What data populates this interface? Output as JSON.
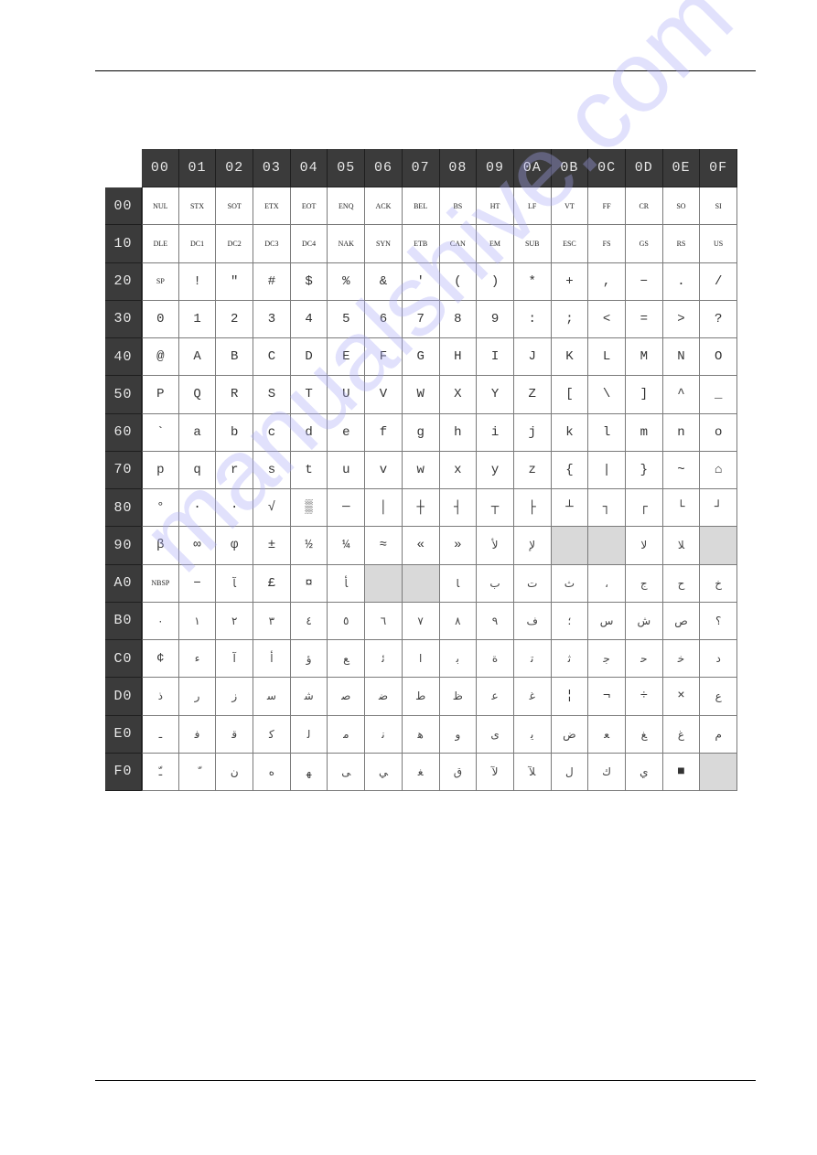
{
  "document": {
    "watermark": "manualshive.com"
  },
  "code_table": {
    "column_headers": [
      "00",
      "01",
      "02",
      "03",
      "04",
      "05",
      "06",
      "07",
      "08",
      "09",
      "0A",
      "0B",
      "0C",
      "0D",
      "0E",
      "0F"
    ],
    "rows": [
      {
        "header": "00",
        "cells": [
          "NUL",
          "STX",
          "SOT",
          "ETX",
          "EOT",
          "ENQ",
          "ACK",
          "BEL",
          "BS",
          "HT",
          "LF",
          "VT",
          "FF",
          "CR",
          "SO",
          "SI"
        ]
      },
      {
        "header": "10",
        "cells": [
          "DLE",
          "DC1",
          "DC2",
          "DC3",
          "DC4",
          "NAK",
          "SYN",
          "ETB",
          "CAN",
          "EM",
          "SUB",
          "ESC",
          "FS",
          "GS",
          "RS",
          "US"
        ]
      },
      {
        "header": "20",
        "cells": [
          "SP",
          "!",
          "\"",
          "#",
          "$",
          "%",
          "&",
          "'",
          "(",
          ")",
          "*",
          "+",
          ",",
          "−",
          ".",
          "/"
        ]
      },
      {
        "header": "30",
        "cells": [
          "0",
          "1",
          "2",
          "3",
          "4",
          "5",
          "6",
          "7",
          "8",
          "9",
          ":",
          ";",
          "<",
          "=",
          ">",
          "?"
        ]
      },
      {
        "header": "40",
        "cells": [
          "@",
          "A",
          "B",
          "C",
          "D",
          "E",
          "F",
          "G",
          "H",
          "I",
          "J",
          "K",
          "L",
          "M",
          "N",
          "O"
        ]
      },
      {
        "header": "50",
        "cells": [
          "P",
          "Q",
          "R",
          "S",
          "T",
          "U",
          "V",
          "W",
          "X",
          "Y",
          "Z",
          "[",
          "\\",
          "]",
          "^",
          "_"
        ]
      },
      {
        "header": "60",
        "cells": [
          "`",
          "a",
          "b",
          "c",
          "d",
          "e",
          "f",
          "g",
          "h",
          "i",
          "j",
          "k",
          "l",
          "m",
          "n",
          "o"
        ]
      },
      {
        "header": "70",
        "cells": [
          "p",
          "q",
          "r",
          "s",
          "t",
          "u",
          "v",
          "w",
          "x",
          "y",
          "z",
          "{",
          "|",
          "}",
          "~",
          "⌂"
        ]
      },
      {
        "header": "80",
        "cells": [
          "°",
          "·",
          "∙",
          "√",
          "▒",
          "─",
          "│",
          "┼",
          "┤",
          "┬",
          "├",
          "┴",
          "┐",
          "┌",
          "└",
          "┘"
        ]
      },
      {
        "header": "90",
        "cells": [
          "β",
          "∞",
          "φ",
          "±",
          "½",
          "¼",
          "≈",
          "«",
          "»",
          "ﻷ",
          "ﻹ",
          "",
          "",
          "ﻻ",
          "ﻼ",
          ""
        ]
      },
      {
        "header": "A0",
        "cells": [
          "NBSP",
          "−",
          "ﺂ",
          "£",
          "¤",
          "ﺄ",
          "",
          "",
          "ﺎ",
          "ﺏ",
          "ﺕ",
          "ﺙ",
          "،",
          "ﺝ",
          "ﺡ",
          "ﺥ"
        ]
      },
      {
        "header": "B0",
        "cells": [
          "٠",
          "١",
          "٢",
          "٣",
          "٤",
          "٥",
          "٦",
          "٧",
          "٨",
          "٩",
          "ﻑ",
          "؛",
          "ﺱ",
          "ﺵ",
          "ﺹ",
          "؟"
        ]
      },
      {
        "header": "C0",
        "cells": [
          "¢",
          "ﺀ",
          "ﺁ",
          "ﺃ",
          "ﺅ",
          "ﻊ",
          "ﺋ",
          "ﺍ",
          "ﺑ",
          "ﺓ",
          "ﺗ",
          "ﺛ",
          "ﺟ",
          "ﺣ",
          "ﺧ",
          "ﺩ"
        ]
      },
      {
        "header": "D0",
        "cells": [
          "ﺫ",
          "ﺭ",
          "ﺯ",
          "ﺳ",
          "ﺷ",
          "ﺻ",
          "ﺿ",
          "ﻁ",
          "ﻅ",
          "ﻋ",
          "ﻏ",
          "¦",
          "¬",
          "÷",
          "×",
          "ﻉ"
        ]
      },
      {
        "header": "E0",
        "cells": [
          "ـ",
          "ﻓ",
          "ﻗ",
          "ﻛ",
          "ﻟ",
          "ﻣ",
          "ﻧ",
          "ﻫ",
          "ﻭ",
          "ﻯ",
          "ﻳ",
          "ﺽ",
          "ﻌ",
          "ﻎ",
          "ﻍ",
          "ﻡ"
        ]
      },
      {
        "header": "F0",
        "cells": [
          "ﹽ",
          "ّ",
          "ﻥ",
          "ﻩ",
          "ﻬ",
          "ﻰ",
          "ﻲ",
          "ﻐ",
          "ﻕ",
          "ﻵ",
          "ﻶ",
          "ﻝ",
          "ﻙ",
          "ﻱ",
          "■",
          ""
        ]
      }
    ],
    "empty_cells": [
      [
        "90",
        "0B"
      ],
      [
        "90",
        "0C"
      ],
      [
        "90",
        "0F"
      ],
      [
        "A0",
        "06"
      ],
      [
        "A0",
        "07"
      ],
      [
        "F0",
        "0F"
      ]
    ],
    "colors": {
      "header_bg": "#3b3b3b",
      "header_text": "#e8e8e8",
      "empty_cell_bg": "#d9d9d9",
      "cell_bg": "#ffffff"
    }
  }
}
